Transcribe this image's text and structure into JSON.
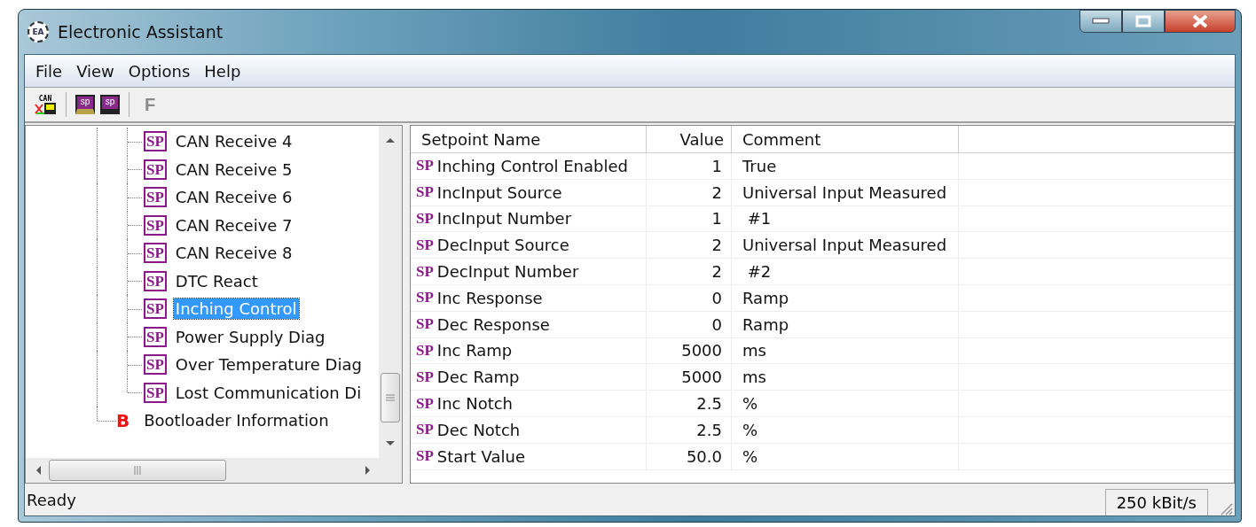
{
  "window": {
    "title": "Electronic Assistant",
    "logo": "EA"
  },
  "menu": [
    "File",
    "View",
    "Options",
    "Help"
  ],
  "toolbar": [
    {
      "kind": "can",
      "label": "CAN",
      "disabled": false
    },
    {
      "kind": "sep"
    },
    {
      "kind": "open",
      "label": "sp",
      "disabled": false
    },
    {
      "kind": "save",
      "label": "sp",
      "disabled": false
    },
    {
      "kind": "sep"
    },
    {
      "kind": "text",
      "label": "F",
      "disabled": true
    }
  ],
  "tree": {
    "items": [
      {
        "kind": "group",
        "children": [
          {
            "kind": "setpoint",
            "badge": "SP",
            "label": "CAN Receive 4",
            "selected": false
          },
          {
            "kind": "setpoint",
            "badge": "SP",
            "label": "CAN Receive 5",
            "selected": false
          },
          {
            "kind": "setpoint",
            "badge": "SP",
            "label": "CAN Receive 6",
            "selected": false
          },
          {
            "kind": "setpoint",
            "badge": "SP",
            "label": "CAN Receive 7",
            "selected": false
          },
          {
            "kind": "setpoint",
            "badge": "SP",
            "label": "CAN Receive 8",
            "selected": false
          },
          {
            "kind": "setpoint",
            "badge": "SP",
            "label": "DTC React",
            "selected": false
          },
          {
            "kind": "setpoint",
            "badge": "SP",
            "label": "Inching Control",
            "selected": true
          },
          {
            "kind": "setpoint",
            "badge": "SP",
            "label": "Power Supply Diag",
            "selected": false
          },
          {
            "kind": "setpoint",
            "badge": "SP",
            "label": "Over Temperature Diag",
            "selected": false
          },
          {
            "kind": "setpoint",
            "badge": "SP",
            "label": "Lost Communication Di",
            "selected": false
          }
        ]
      },
      {
        "kind": "bootloader",
        "badge": "B",
        "label": "Bootloader Information",
        "selected": false
      }
    ]
  },
  "table": {
    "columns": [
      "Setpoint Name",
      "Value",
      "Comment"
    ],
    "rows": [
      {
        "badge": "SP",
        "name": "Inching Control Enabled",
        "value": "1",
        "comment": "True"
      },
      {
        "badge": "SP",
        "name": "IncInput Source",
        "value": "2",
        "comment": "Universal Input Measured"
      },
      {
        "badge": "SP",
        "name": "IncInput Number",
        "value": "1",
        "comment": " #1"
      },
      {
        "badge": "SP",
        "name": "DecInput Source",
        "value": "2",
        "comment": "Universal Input Measured"
      },
      {
        "badge": "SP",
        "name": "DecInput Number",
        "value": "2",
        "comment": " #2"
      },
      {
        "badge": "SP",
        "name": "Inc Response",
        "value": "0",
        "comment": "Ramp"
      },
      {
        "badge": "SP",
        "name": "Dec Response",
        "value": "0",
        "comment": "Ramp"
      },
      {
        "badge": "SP",
        "name": "Inc Ramp",
        "value": "5000",
        "comment": "ms"
      },
      {
        "badge": "SP",
        "name": "Dec Ramp",
        "value": "5000",
        "comment": "ms"
      },
      {
        "badge": "SP",
        "name": "Inc Notch",
        "value": "2.5",
        "comment": "%"
      },
      {
        "badge": "SP",
        "name": "Dec Notch",
        "value": "2.5",
        "comment": "%"
      },
      {
        "badge": "SP",
        "name": "Start Value",
        "value": "50.0",
        "comment": "%"
      }
    ]
  },
  "status_bar": {
    "text": "Ready",
    "baud": "250 kBit/s"
  }
}
